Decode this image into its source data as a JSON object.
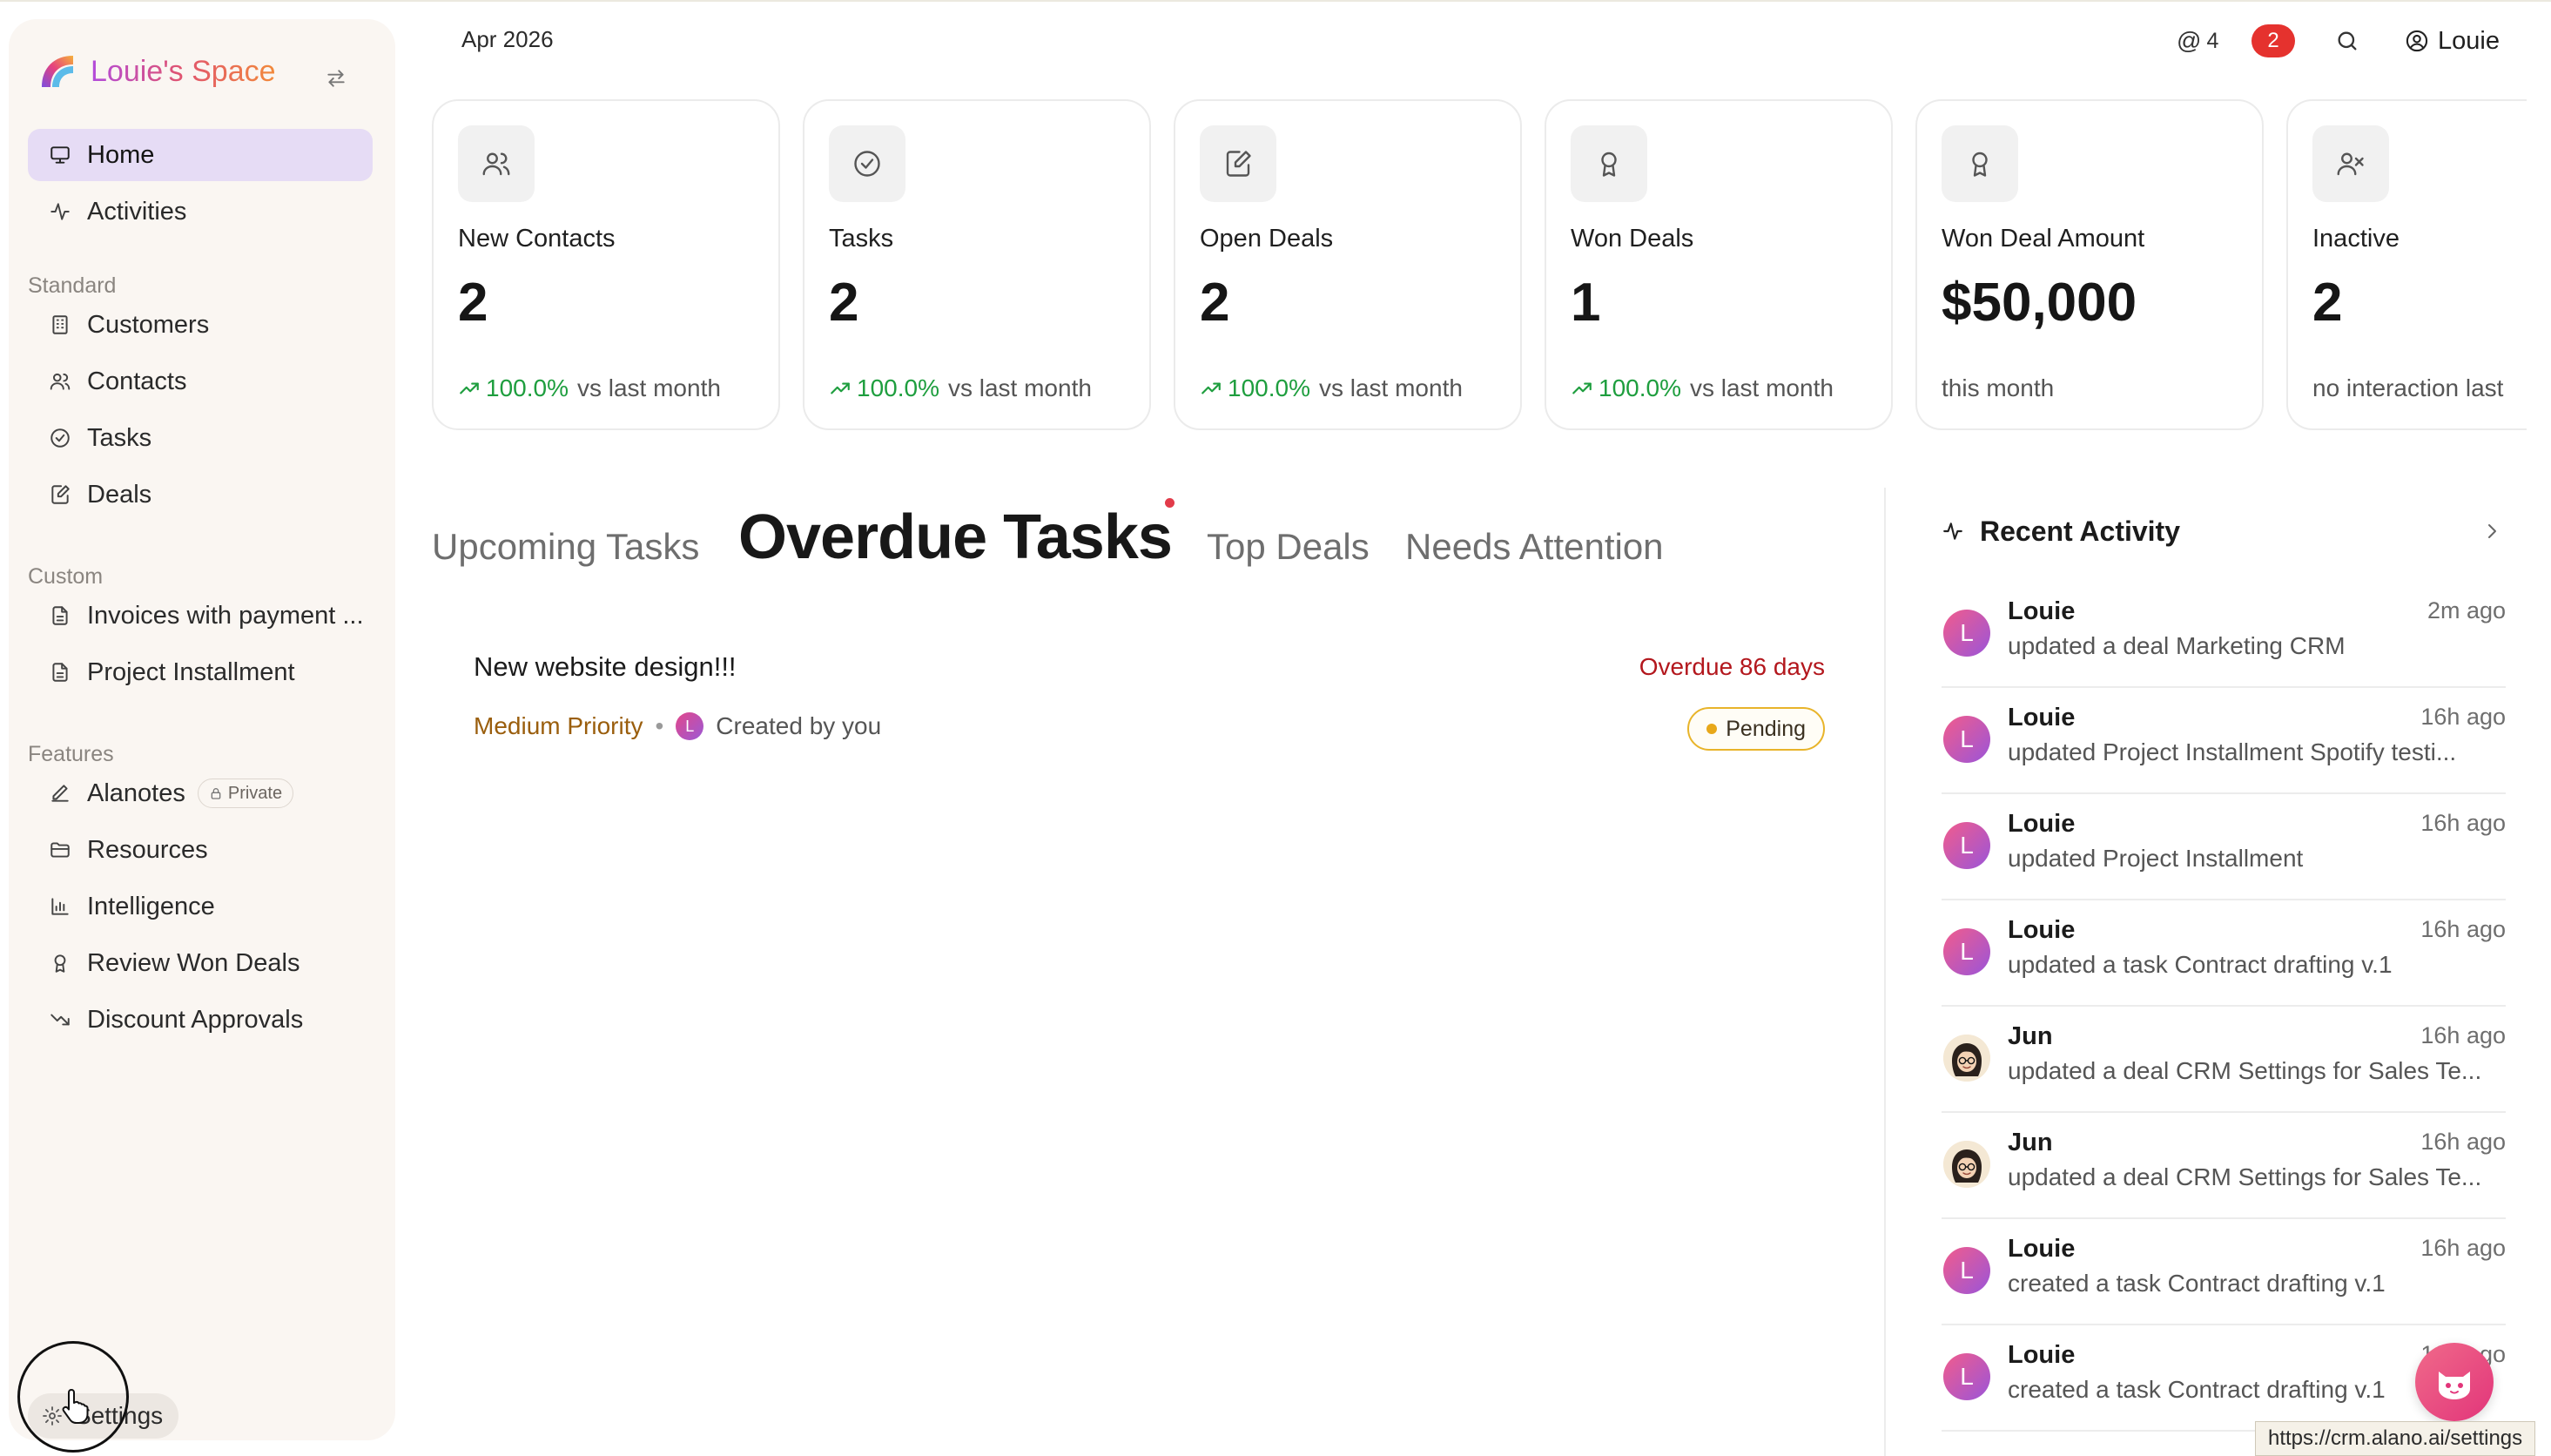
{
  "header": {
    "date": "Apr 2026",
    "mentions_count": "4",
    "notifications_count": "2",
    "user_name": "Louie"
  },
  "sidebar": {
    "brand": "Louie's Space",
    "main_items": [
      {
        "label": "Home",
        "icon": "monitor-icon",
        "active": true
      },
      {
        "label": "Activities",
        "icon": "activity-icon"
      }
    ],
    "standard_label": "Standard",
    "standard_items": [
      {
        "label": "Customers",
        "icon": "building-icon"
      },
      {
        "label": "Contacts",
        "icon": "users-icon"
      },
      {
        "label": "Tasks",
        "icon": "check-circle-icon"
      },
      {
        "label": "Deals",
        "icon": "edit-doc-icon"
      }
    ],
    "custom_label": "Custom",
    "custom_items": [
      {
        "label": "Invoices with payment ...",
        "icon": "file-icon"
      },
      {
        "label": "Project Installment",
        "icon": "file-icon"
      }
    ],
    "features_label": "Features",
    "features_items": [
      {
        "label": "Alanotes",
        "icon": "pen-icon",
        "badge": "Private"
      },
      {
        "label": "Resources",
        "icon": "folder-icon"
      },
      {
        "label": "Intelligence",
        "icon": "bar-chart-icon"
      },
      {
        "label": "Review Won Deals",
        "icon": "award-icon"
      },
      {
        "label": "Discount Approvals",
        "icon": "trending-down-icon"
      }
    ],
    "settings_label": "Settings"
  },
  "stats": [
    {
      "label": "New Contacts",
      "value": "2",
      "pct": "100.0%",
      "suffix": "vs last month",
      "icon": "users-icon"
    },
    {
      "label": "Tasks",
      "value": "2",
      "pct": "100.0%",
      "suffix": "vs last month",
      "icon": "check-circle-icon"
    },
    {
      "label": "Open Deals",
      "value": "2",
      "pct": "100.0%",
      "suffix": "vs last month",
      "icon": "edit-doc-icon"
    },
    {
      "label": "Won Deals",
      "value": "1",
      "pct": "100.0%",
      "suffix": "vs last month",
      "icon": "award-icon"
    },
    {
      "label": "Won Deal Amount",
      "value": "$50,000",
      "pct": "",
      "suffix": "this month",
      "icon": "award-icon"
    },
    {
      "label": "Inactive",
      "value": "2",
      "pct": "",
      "suffix": "no interaction last",
      "icon": "user-x-icon"
    }
  ],
  "tabs": {
    "upcoming": "Upcoming Tasks",
    "overdue": "Overdue Tasks",
    "top_deals": "Top Deals",
    "needs_attention": "Needs Attention"
  },
  "task": {
    "title": "New website design!!!",
    "overdue": "Overdue 86 days",
    "priority": "Medium Priority",
    "avatar_letter": "L",
    "created_by": "Created by you",
    "status": "Pending"
  },
  "recent_activity": {
    "title": "Recent Activity",
    "items": [
      {
        "name": "Louie",
        "time": "2m ago",
        "text": "updated a deal Marketing CRM",
        "avatar": "L"
      },
      {
        "name": "Louie",
        "time": "16h ago",
        "text": "updated Project Installment Spotify testi...",
        "avatar": "L"
      },
      {
        "name": "Louie",
        "time": "16h ago",
        "text": "updated Project Installment",
        "avatar": "L"
      },
      {
        "name": "Louie",
        "time": "16h ago",
        "text": "updated a task Contract drafting v.1",
        "avatar": "L"
      },
      {
        "name": "Jun",
        "time": "16h ago",
        "text": "updated a deal CRM Settings for Sales Te...",
        "avatar": "jun"
      },
      {
        "name": "Jun",
        "time": "16h ago",
        "text": "updated a deal CRM Settings for Sales Te...",
        "avatar": "jun"
      },
      {
        "name": "Louie",
        "time": "16h ago",
        "text": "created a task Contract drafting v.1",
        "avatar": "L"
      },
      {
        "name": "Louie",
        "time": "16h ago",
        "text": "created a task Contract drafting v.1",
        "avatar": "L"
      }
    ]
  },
  "status_bar": {
    "url": "https://crm.alano.ai/settings"
  },
  "colors": {
    "accent_active": "#e6dcf5",
    "positive": "#1e9e3e",
    "overdue": "#b3171d",
    "priority": "#9a5e0d",
    "badge_red": "#e5322e"
  }
}
